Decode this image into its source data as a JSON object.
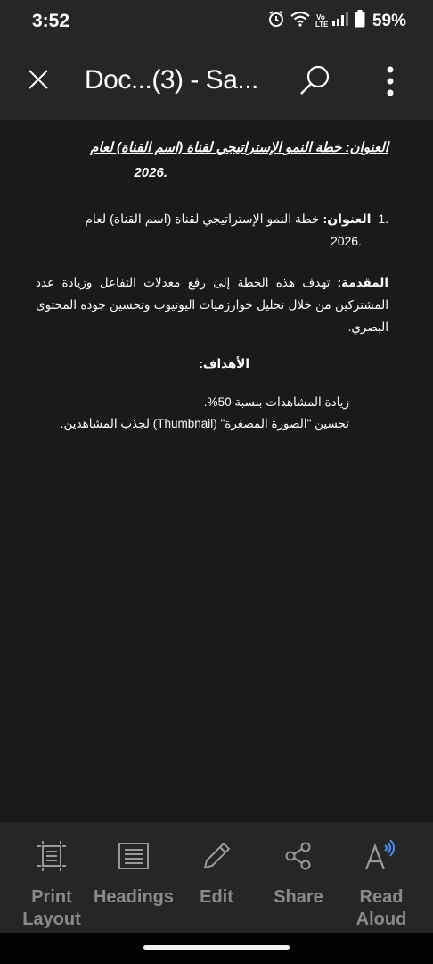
{
  "status_bar": {
    "time": "3:52",
    "volte": "Vo LTE",
    "battery": "59%"
  },
  "app_bar": {
    "title": "Doc...(3) - Sa...",
    "close_icon": "close-icon",
    "search_icon": "search-icon",
    "more_icon": "more-vert-icon"
  },
  "document": {
    "title_line": "العنوان: خطة النمو الإستراتيجي لقناة (اسم القناة) لعام",
    "title_year": ".2026",
    "list_num": ".1",
    "list_label": "العنوان:",
    "list_text": "خطة النمو الإستراتيجي لقناة (اسم القناة) لعام",
    "list_year": ".2026",
    "intro_label": "المقدمة:",
    "intro_text": "تهدف هذه الخطة إلى رفع معدلات التفاعل وزيادة عدد المشتركين من خلال تحليل خوارزميات اليوتيوب وتحسين جودة المحتوى البصري.",
    "goals_heading": "الأهداف:",
    "goal_1": "زيادة المشاهدات بنسبة 50%.",
    "goal_2": "تحسين \"الصورة المصغرة\" (Thumbnail) لجذب المشاهدين."
  },
  "toolbar": {
    "items": [
      {
        "label": "Print Layout",
        "icon": "print-layout-icon"
      },
      {
        "label": "Headings",
        "icon": "headings-icon"
      },
      {
        "label": "Edit",
        "icon": "edit-pencil-icon"
      },
      {
        "label": "Share",
        "icon": "share-icon"
      },
      {
        "label": "Read Aloud",
        "icon": "read-aloud-icon"
      }
    ]
  },
  "colors": {
    "background": "#1a1a1a",
    "bars": "#262626",
    "toolbar_label": "#8a8a8a",
    "text": "#ffffff"
  }
}
